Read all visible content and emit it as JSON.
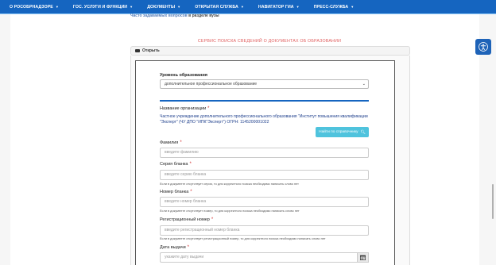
{
  "nav": {
    "items": [
      {
        "label": "О РОСОБРНАДЗОРЕ"
      },
      {
        "label": "ГОС. УСЛУГИ И ФУНКЦИИ"
      },
      {
        "label": "ДОКУМЕНТЫ"
      },
      {
        "label": "ОТКРЫТАЯ СЛУЖБА"
      },
      {
        "label": "НАВИГАТОР ГИА"
      },
      {
        "label": "ПРЕСС-СЛУЖБА"
      }
    ],
    "bar_color": "#1565c0"
  },
  "faq": {
    "link": "Часто задаваемых вопросов",
    "rest": " в разделе вузы"
  },
  "service_title": "СЕРВИС ПОИСКА СВЕДЕНИЙ О ДОКУМЕНТАХ ОБ ОБРАЗОВАНИИ",
  "panel": {
    "header_label": "Открыть"
  },
  "form": {
    "education_level": {
      "label": "Уровень образования",
      "selected": "дополнительное профессиональное образование"
    },
    "organization": {
      "label": "Название организации",
      "value": "Частное учреждение дополнительного профессионального образования \"Институт повышения квалификации \"Эксперт\" (ЧУ ДПО \"ИПК\"Эксперт\") ОГРН: 1145200001022"
    },
    "reference_button": "Найти по справочнику",
    "surname": {
      "label": "Фамилия",
      "placeholder": "введите фамилию"
    },
    "series": {
      "label": "Серия бланка",
      "placeholder": "введите серию бланка",
      "hint": "Если в документе отсутствует серия, то для корректного поиска необходимо написать слово нет"
    },
    "number": {
      "label": "Номер бланка",
      "placeholder": "введите номер бланка",
      "hint": "Если в документе отсутствует номер, то для корректного поиска необходимо написать слово нет"
    },
    "reg_number": {
      "label": "Регистрационный номер",
      "placeholder": "введите регистрационный номер бланка",
      "hint": "Если в документе отсутствует регистрационный номер, то для корректного поиска необходимо написать слово нет"
    },
    "issue_date": {
      "label": "Дата выдачи",
      "placeholder": "укажите дату выдачи"
    }
  },
  "icons": {
    "accessibility": "accessibility-icon",
    "folder": "folder-open-icon",
    "search": "search-icon",
    "calendar": "calendar-icon"
  }
}
